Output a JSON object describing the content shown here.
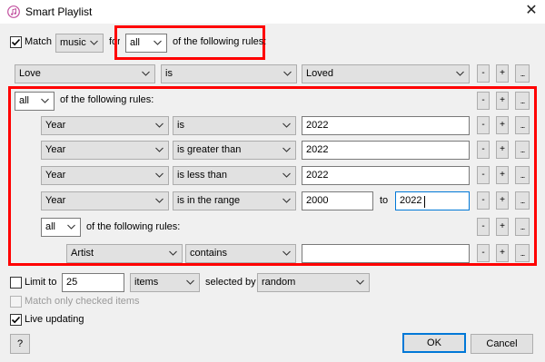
{
  "window": {
    "title": "Smart Playlist",
    "close_label": "✕"
  },
  "header": {
    "match_checked": true,
    "match_label": "Match",
    "media_type": "music",
    "for_label": "for",
    "logic": "all",
    "following_label": "of the following rules:"
  },
  "rules": {
    "top_rule": {
      "field": "Love",
      "operator": "is",
      "value": "Loved"
    },
    "group": {
      "logic": "all",
      "following_label": "of the following rules:",
      "rows": [
        {
          "field": "Year",
          "operator": "is",
          "value": "2022"
        },
        {
          "field": "Year",
          "operator": "is greater than",
          "value": "2022"
        },
        {
          "field": "Year",
          "operator": "is less than",
          "value": "2022"
        },
        {
          "field": "Year",
          "operator": "is in the range",
          "value": "2000",
          "to_label": "to",
          "value2": "2022"
        }
      ],
      "subgroup": {
        "logic": "all",
        "following_label": "of the following rules:",
        "row": {
          "field": "Artist",
          "operator": "contains",
          "value": ""
        }
      }
    }
  },
  "controls": {
    "remove": "-",
    "add": "+",
    "more": "..."
  },
  "limit": {
    "checked": false,
    "label": "Limit to",
    "value": "25",
    "unit": "items",
    "selected_by_label": "selected by",
    "selected_by": "random"
  },
  "match_only_checked": {
    "checked": false,
    "enabled": false,
    "label": "Match only checked items"
  },
  "live_updating": {
    "checked": true,
    "label": "Live updating"
  },
  "footer": {
    "help": "?",
    "ok": "OK",
    "cancel": "Cancel"
  },
  "colors": {
    "highlight": "#ff0000",
    "accent": "#0078d7",
    "dialog_bg": "#f0f0f0"
  }
}
